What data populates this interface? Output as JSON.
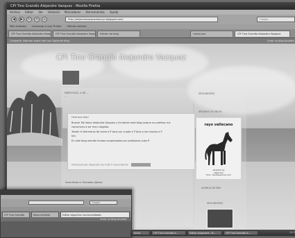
{
  "browser": {
    "window_title": "CPI Tino Grandío Alejandro Vazquez - Mozilla Firefox",
    "menu": [
      "Archivo",
      "Editar",
      "Ver",
      "Historial",
      "Marcadores",
      "Herramientas",
      "Ayuda"
    ],
    "url": "http://alejandrovazquezfourcpi.blogspot.com/",
    "search_placeholder": "Google",
    "bookmarks": [
      "Más visitados",
      "Comenzar a usar Firefox",
      "Últimas noticias"
    ],
    "tabs": [
      "CPI Tino Grandío Alejandro Vazquez",
      "CPI Tino Grandío Alejandro Vazquez",
      "Edición de blog",
      "raiduil pas",
      "CPI Tino Grandío Alejandro Vazquez"
    ]
  },
  "blog": {
    "navbar_left": "Compartir  Informar sobre mal uso  Siguiente blog",
    "navbar_right": "Crear un blog  Acceder",
    "title": "CPI Tino Grandío Alejandro Vazquez",
    "post_date": "MIÉRCOLES, 4 DE ...",
    "post_heading": "...",
    "post_greeting": "Hola bos días!",
    "post_lines": [
      "Bueno! Me llamo Alejandro Vazquez y fai dende onte blog porque un profesor me",
      "convenceu a ser meu cargado.",
      "Tamén é informaros de como a P toca con a pala e P toca a ser cavoiro a P",
      "tan.",
      "En este blog mandei imaxes sengranadas por profesores suas P."
    ],
    "post_footer": "Publicado por Alejandro ás 4:36     0 comentarios",
    "home_link": "Página principal",
    "subscribe": "Suscribirse a: Entradas (Atom)",
    "sidebar_seguidores": "SEGUIDORES",
    "sidebar_archive": "ARQUIVO DO BLOG",
    "sidebar_about": "ACERCA DE MIN",
    "widget_title": "rayo vallecano",
    "widget_caption": [
      "adopted by",
      "alejandro",
      "from: landapalooza.com"
    ],
    "sidebar_label_2": "SEGUIDORES"
  },
  "window2": {
    "search_text": "Google",
    "tabs": [
      "CPI Tino Grandío",
      "Nova entrada",
      "Edición de blog"
    ],
    "active_tab": "Editar algunhas funcionalidades",
    "top_right": "Crear un blog  Acceder"
  },
  "taskbar": {
    "items": [
      "Inicio",
      "CPI Tino Grandío A...",
      "Editor programa - B...",
      "CPI Tino Grandío A..."
    ],
    "clock": "11:33"
  }
}
